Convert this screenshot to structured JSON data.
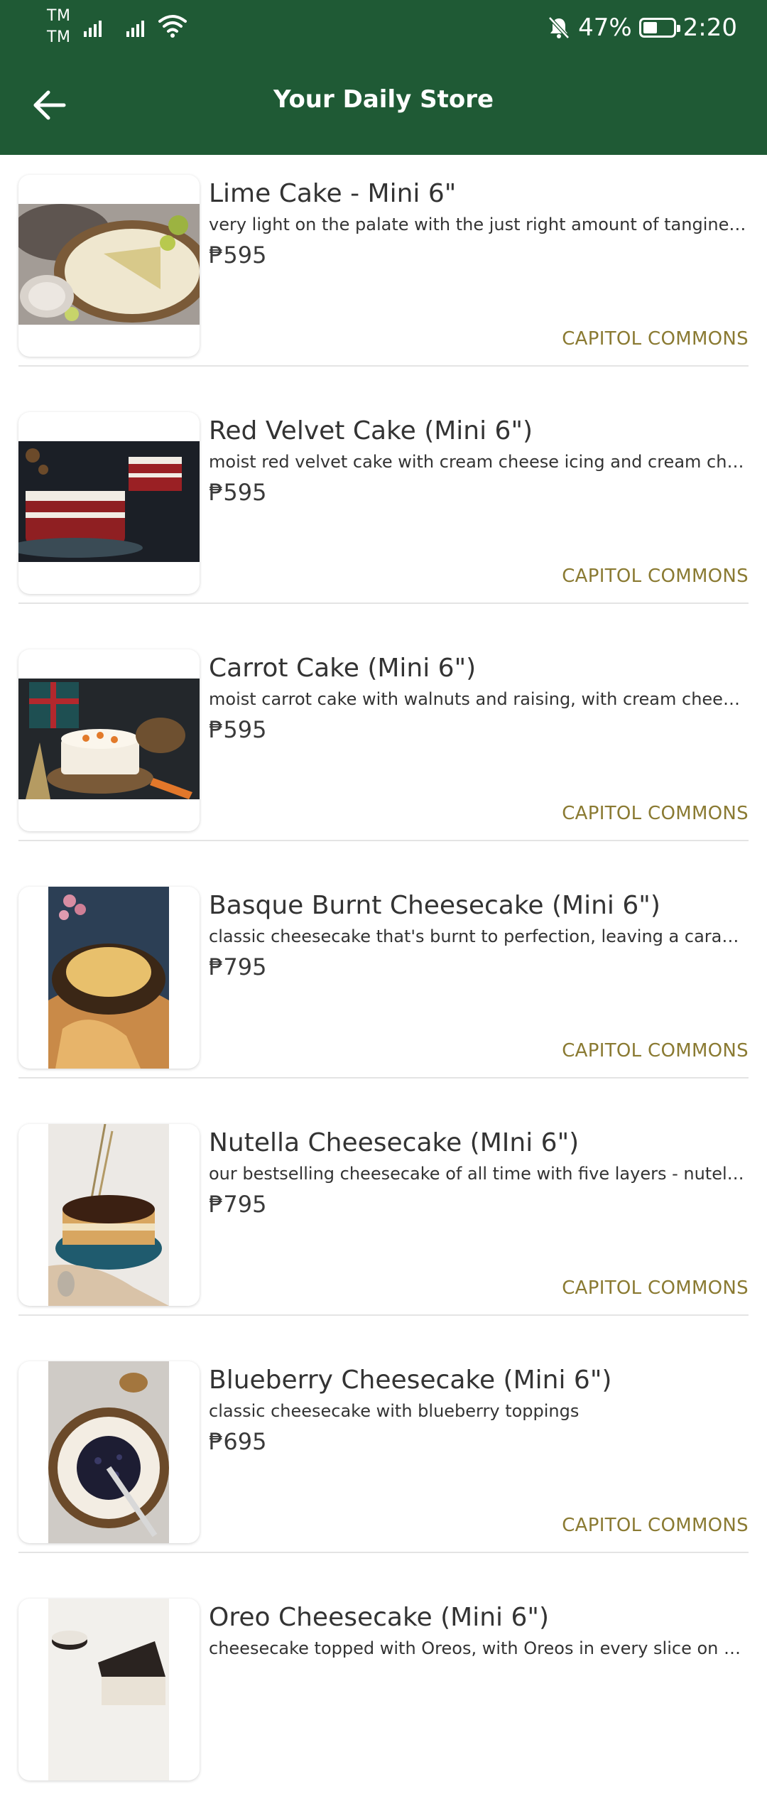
{
  "status_bar": {
    "carrier_top": "TM",
    "carrier_bottom": "TM",
    "battery_percent": "47%",
    "battery_level": 0.47,
    "time": "2:20"
  },
  "app_bar": {
    "title": "Your Daily Store"
  },
  "products": [
    {
      "name": "Lime Cake - Mini 6\"",
      "description": "very light on the palate with the just right amount of tanginess, l...",
      "price": "₱595",
      "location": "CAPITOL COMMONS"
    },
    {
      "name": "Red Velvet Cake (Mini 6\")",
      "description": "moist red velvet cake with cream cheese icing and cream chee...",
      "price": "₱595",
      "location": "CAPITOL COMMONS"
    },
    {
      "name": "Carrot Cake (Mini 6\")",
      "description": "moist carrot cake with walnuts and raising, with cream cheese i...",
      "price": "₱595",
      "location": "CAPITOL COMMONS"
    },
    {
      "name": "Basque Burnt Cheesecake (Mini 6\")",
      "description": "classic cheesecake that's burnt to perfection, leaving a caramel...",
      "price": "₱795",
      "location": "CAPITOL COMMONS"
    },
    {
      "name": "Nutella Cheesecake (MIni 6\")",
      "description": "our bestselling cheesecake of all time with five layers - nutella, ...",
      "price": "₱795",
      "location": "CAPITOL COMMONS"
    },
    {
      "name": "Blueberry Cheesecake (Mini 6\")",
      "description": "classic cheesecake with blueberry toppings",
      "price": "₱695",
      "location": "CAPITOL COMMONS"
    },
    {
      "name": "Oreo Cheesecake (Mini 6\")",
      "description": "cheesecake topped with Oreos, with Oreos in every slice on Ore...",
      "price": "",
      "location": ""
    }
  ],
  "colors": {
    "primary": "#1f5a35",
    "location_text": "#8a7a32"
  }
}
